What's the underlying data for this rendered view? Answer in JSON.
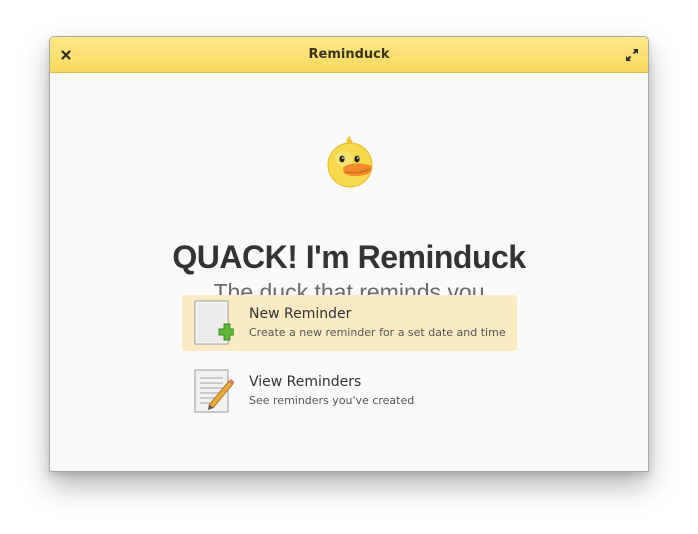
{
  "window": {
    "title": "Reminduck",
    "close_icon": "close-icon",
    "maximize_icon": "maximize-icon",
    "titlebar_color": "#f9d95c"
  },
  "welcome": {
    "logo_icon": "duck-icon",
    "headline": "QUACK! I'm Reminduck",
    "subheadline": "The duck that reminds you"
  },
  "actions": [
    {
      "icon": "new-document-icon",
      "title": "New Reminder",
      "description": "Create a new reminder for a set date and time",
      "selected": true
    },
    {
      "icon": "edit-document-icon",
      "title": "View Reminders",
      "description": "See reminders you've created",
      "selected": false
    }
  ],
  "colors": {
    "selection": "#fbebc5",
    "accent_green": "#5fb83a",
    "duck_yellow": "#f7d94c",
    "beak_orange": "#f08a2a"
  }
}
